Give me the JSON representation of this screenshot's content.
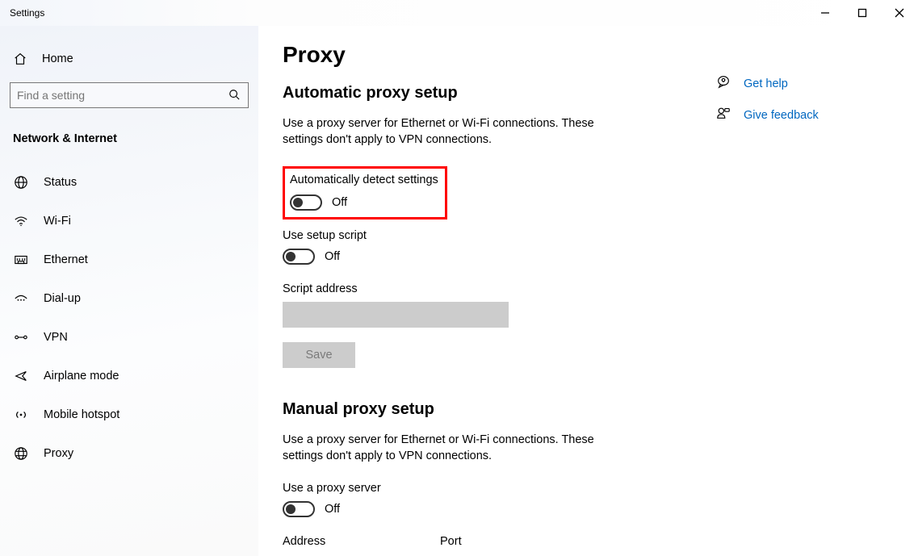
{
  "window": {
    "title": "Settings"
  },
  "sidebar": {
    "home": "Home",
    "search_placeholder": "Find a setting",
    "category": "Network & Internet",
    "items": [
      {
        "label": "Status",
        "icon": "global-icon"
      },
      {
        "label": "Wi-Fi",
        "icon": "wifi-icon"
      },
      {
        "label": "Ethernet",
        "icon": "ethernet-icon"
      },
      {
        "label": "Dial-up",
        "icon": "dialup-icon"
      },
      {
        "label": "VPN",
        "icon": "vpn-icon"
      },
      {
        "label": "Airplane mode",
        "icon": "airplane-icon"
      },
      {
        "label": "Mobile hotspot",
        "icon": "hotspot-icon"
      },
      {
        "label": "Proxy",
        "icon": "proxy-icon"
      }
    ]
  },
  "page": {
    "title": "Proxy",
    "auto": {
      "heading": "Automatic proxy setup",
      "desc": "Use a proxy server for Ethernet or Wi-Fi connections. These settings don't apply to VPN connections.",
      "auto_detect_label": "Automatically detect settings",
      "auto_detect_state": "Off",
      "use_script_label": "Use setup script",
      "use_script_state": "Off",
      "script_address_label": "Script address",
      "script_address_value": "",
      "save_label": "Save"
    },
    "manual": {
      "heading": "Manual proxy setup",
      "desc": "Use a proxy server for Ethernet or Wi-Fi connections. These settings don't apply to VPN connections.",
      "use_proxy_label": "Use a proxy server",
      "use_proxy_state": "Off",
      "address_label": "Address",
      "port_label": "Port"
    }
  },
  "right": {
    "help": "Get help",
    "feedback": "Give feedback"
  }
}
